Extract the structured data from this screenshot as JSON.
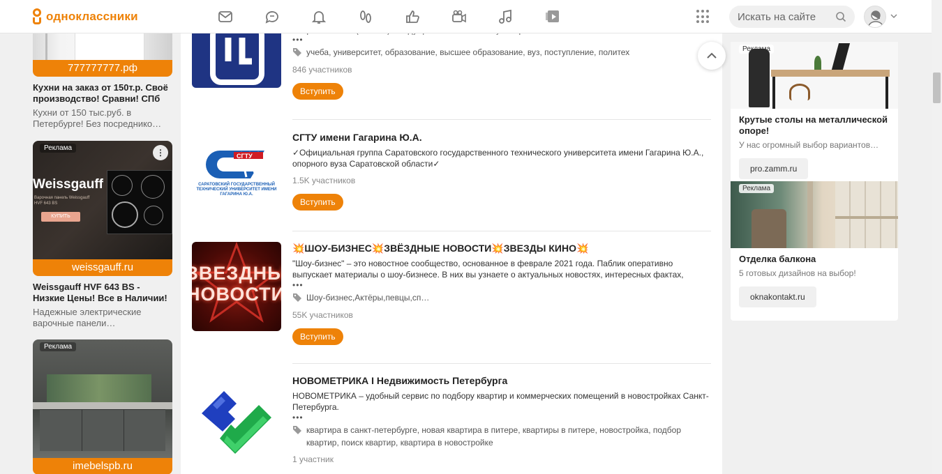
{
  "header": {
    "logo_text": "одноклассники",
    "search_placeholder": "Искать на сайте",
    "nav": [
      "messages-icon",
      "discussions-icon",
      "notifications-icon",
      "guests-icon",
      "marks-icon",
      "video-icon",
      "music-icon",
      "video-showcase-icon"
    ]
  },
  "left_ads": [
    {
      "domain": "777777777.рф",
      "title": "Кухни на заказ от 150т.р. Своё производство! Сравни! СПб",
      "desc": "Кухни от 150 тыс.руб. в Петербурге! Без посреднико…"
    },
    {
      "label": "Реклама",
      "brand": "Weissgauff",
      "caption": "Варочная панель Weissgauff HVF 643 BS",
      "cta": "КУПИТЬ",
      "domain": "weissgauff.ru",
      "title": "Weissgauff HVF 643 BS - Низкие Цены! Все в Наличии!",
      "desc": "Надежные электрические варочные панели…"
    },
    {
      "label": "Реклама",
      "domain": "imebelspb.ru"
    }
  ],
  "groups": [
    {
      "title": "",
      "desc": "Петра Великого (СПбПУ) – ведущего технического вуза страны.",
      "tags": "учеба, университет, образование, высшее образование, вуз, поступление, политех",
      "members": "846 участников",
      "join": "Вступить"
    },
    {
      "title": "СГТУ имени Гагарина Ю.А.",
      "logo_caption": "САРАТОВСКИЙ ГОСУДАРСТВЕННЫЙ ТЕХНИЧЕСКИЙ УНИВЕРСИТЕТ ИМЕНИ ГАГАРИНА Ю.А.",
      "logo_mark": "CГТУ",
      "desc": "✓Официальная группа Саратовского государственного технического университета имени Гагарина Ю.А., опорного вуза Саратовской области✓",
      "members": "1.5K участников",
      "join": "Вступить"
    },
    {
      "title": "💥ШОУ-БИЗНЕС💥ЗВЁЗДНЫЕ НОВОСТИ💥ЗВЕЗДЫ КИНО💥",
      "logo_line1": "ЗВЕЗДНЫЕ",
      "logo_line2": "НОВОСТИ",
      "desc": "\"Шоу-бизнес\" – это новостное сообщество, основанное в феврале 2021 года. Паблик оперативно выпускает материалы о шоу-бизнесе. В них вы узнаете о актуальных новостях, интересных фактах,",
      "tags": "Шоу-бизнес,Актёры,певцы,сп…",
      "members": "55K участников",
      "join": "Вступить"
    },
    {
      "title": "НОВОМЕТРИКА I Недвижимость Петербурга",
      "desc": "НОВОМЕТРИКА – удобный сервис по подбору квартир и коммерческих помещений в новостройках Санкт-Петербурга.",
      "tags": "квартира в санкт-петербурге, новая квартира в питере, квартиры в питере, новостройка, подбор квартир, поиск квартир, квартира в новостройке",
      "members": "1 участник"
    }
  ],
  "right_ads": [
    {
      "label": "Реклама",
      "title": "Крутые столы на металлической опоре!",
      "desc": "У нас огромный выбор вариантов…",
      "domain": "pro.zamm.ru"
    },
    {
      "label": "Реклама",
      "title": "Отделка балкона",
      "desc": "5 готовых дизайнов на выбор!",
      "domain": "oknakontakt.ru"
    }
  ],
  "colors": {
    "accent": "#ee8208",
    "divider": "#e5e5e5",
    "background": "#f0f0f0"
  }
}
